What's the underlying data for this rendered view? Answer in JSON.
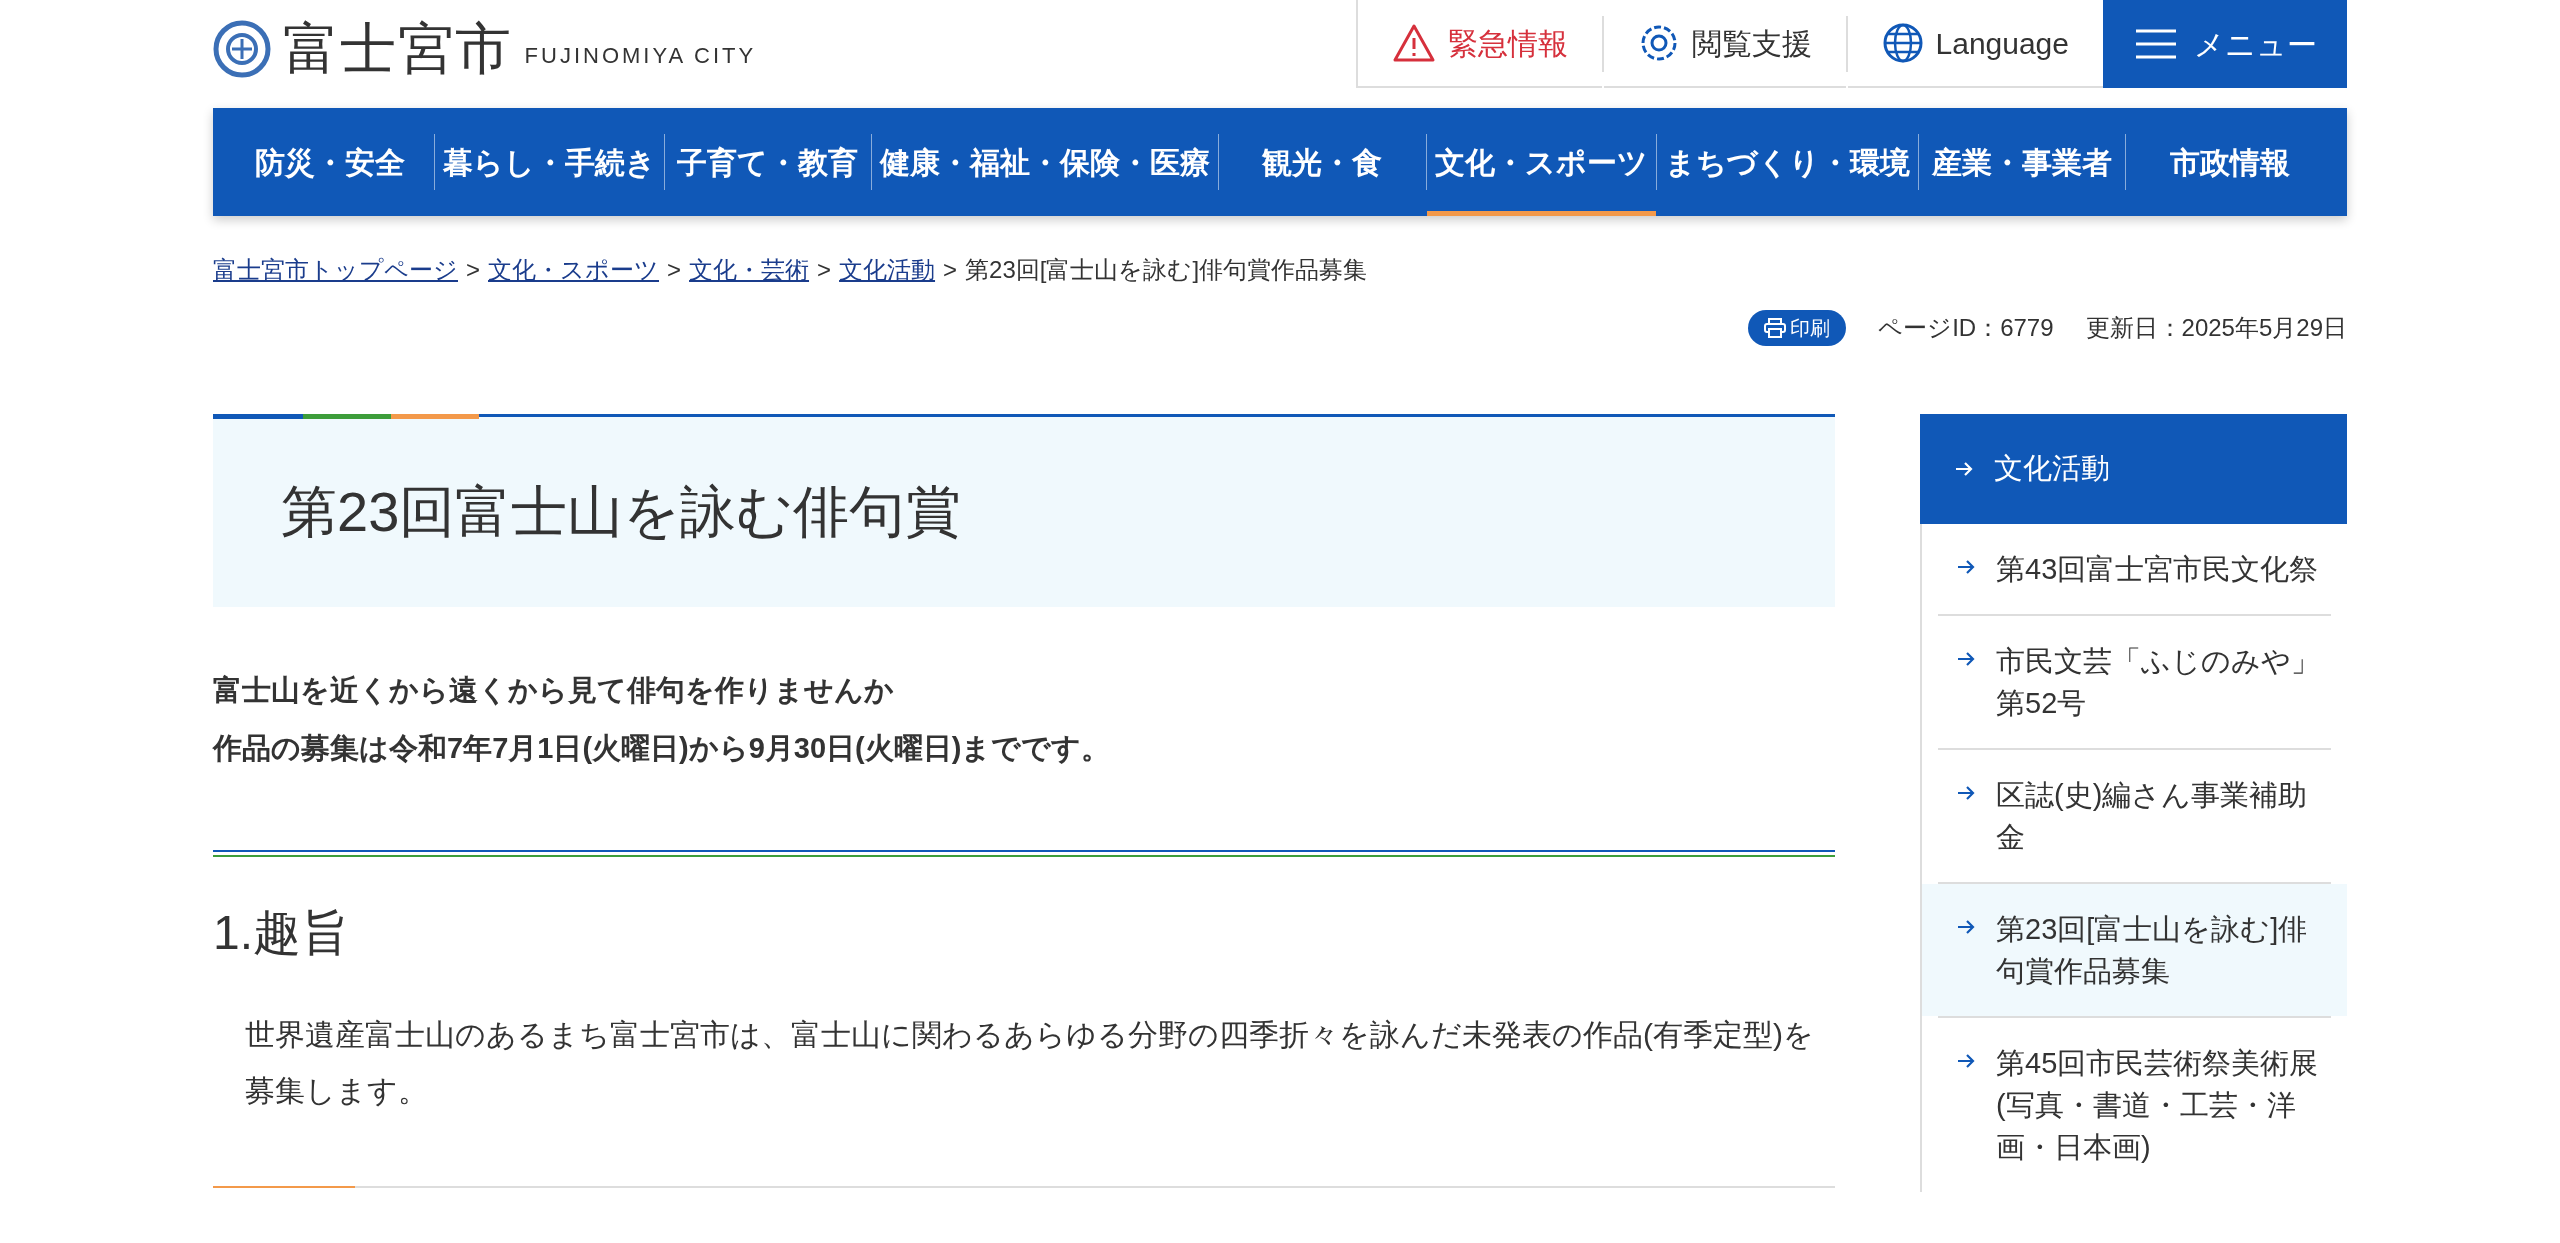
{
  "header": {
    "logo_text": "富士宮市",
    "logo_subtext": "FUJINOMIYA CITY",
    "utility_links": [
      {
        "kind": "emergency",
        "label": "緊急情報"
      },
      {
        "kind": "support",
        "label": "閲覧支援"
      },
      {
        "kind": "language",
        "label": "Language"
      },
      {
        "kind": "menu",
        "label": "メニュー"
      }
    ]
  },
  "global_nav": [
    {
      "label": "防災・安全",
      "selected": false
    },
    {
      "label": "暮らし・手続き",
      "selected": false
    },
    {
      "label": "子育て・教育",
      "selected": false
    },
    {
      "label": "健康・福祉・保険・医療",
      "selected": false
    },
    {
      "label": "観光・食",
      "selected": false
    },
    {
      "label": "文化・スポーツ",
      "selected": true
    },
    {
      "label": "まちづくり・環境",
      "selected": false
    },
    {
      "label": "産業・事業者",
      "selected": false
    },
    {
      "label": "市政情報",
      "selected": false
    }
  ],
  "breadcrumb": {
    "links": [
      "富士宮市トップページ",
      "文化・スポーツ",
      "文化・芸術",
      "文化活動"
    ],
    "separator": ">",
    "current": "第23回[富士山を詠む]俳句賞作品募集"
  },
  "page_info": {
    "print_button": "印刷",
    "page_id": "ページID：6779",
    "updated": "更新日：2025年5月29日"
  },
  "main": {
    "title": "第23回富士山を詠む俳句賞",
    "lead": [
      "富士山を近くから遠くから見て俳句を作りませんか",
      "作品の募集は令和7年7月1日(火曜日)から9月30日(火曜日)までです。"
    ],
    "sections": [
      {
        "heading": "1.趣旨",
        "body": "世界遺産富士山のあるまち富士宮市は、富士山に関わるあらゆる分野の四季折々を詠んだ未発表の作品(有季定型)を募集します。"
      }
    ]
  },
  "sidebar": {
    "heading": "文化活動",
    "items": [
      {
        "label": "第43回富士宮市民文化祭",
        "selected": false
      },
      {
        "label": "市民文芸「ふじのみや」第52号",
        "selected": false
      },
      {
        "label": "区誌(史)編さん事業補助金",
        "selected": false
      },
      {
        "label": "第23回[富士山を詠む]俳句賞作品募集",
        "selected": true
      },
      {
        "label": "第45回市民芸術祭美術展(写真・書道・工芸・洋画・日本画)",
        "selected": false
      }
    ]
  }
}
